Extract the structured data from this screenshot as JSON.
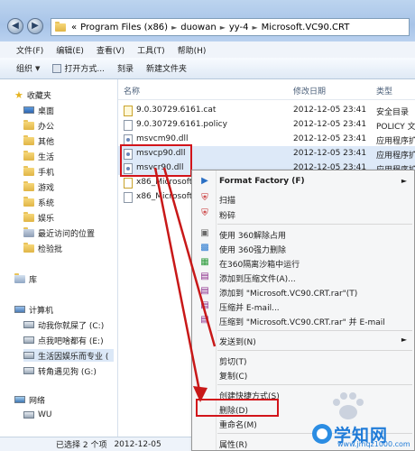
{
  "address": {
    "segments": [
      "«",
      "Program Files (x86)",
      "duowan",
      "yy-4",
      "Microsoft.VC90.CRT"
    ]
  },
  "menubar": [
    "文件(F)",
    "编辑(E)",
    "查看(V)",
    "工具(T)",
    "帮助(H)"
  ],
  "toolbar": {
    "organize": "组织",
    "open_with": "打开方式...",
    "burn": "刻录",
    "new_folder": "新建文件夹"
  },
  "navpane": {
    "favorites": "收藏夹",
    "items": [
      "桌面",
      "办公",
      "其他",
      "生活",
      "手机",
      "游戏",
      "系统",
      "娱乐",
      "最近访问的位置",
      "检验批"
    ],
    "library": "库",
    "computer": "计算机",
    "drives": [
      "动我你就屎了 (C:)",
      "点我吧啥都有 (E:)",
      "生活因娱乐而专业 (",
      "转角遇见狗 (G:)"
    ],
    "network": "网络",
    "network_items": [
      "WU"
    ]
  },
  "columns": {
    "name": "名称",
    "date": "修改日期",
    "type": "类型"
  },
  "files": [
    {
      "name": "9.0.30729.6161.cat",
      "date": "2012-12-05 23:41",
      "type": "安全目录"
    },
    {
      "name": "9.0.30729.6161.policy",
      "date": "2012-12-05 23:41",
      "type": "POLICY 文件"
    },
    {
      "name": "msvcm90.dll",
      "date": "2012-12-05 23:41",
      "type": "应用程序扩"
    },
    {
      "name": "msvcp90.dll",
      "date": "2012-12-05 23:41",
      "type": "应用程序扩"
    },
    {
      "name": "msvcr90.dll",
      "date": "2012-12-05 23:41",
      "type": "应用程序扩"
    },
    {
      "name": "x86_Microsoft.V",
      "date": "",
      "type": ""
    },
    {
      "name": "x86_Microsoft.V",
      "date": "",
      "type": ""
    }
  ],
  "context_menu": {
    "items": [
      {
        "label": "Format Factory (F)",
        "bold": true,
        "submenu": true
      },
      {
        "label": "扫描"
      },
      {
        "label": "粉碎"
      },
      {
        "sep": true
      },
      {
        "label": "使用 360解除占用"
      },
      {
        "label": "使用 360强力删除"
      },
      {
        "label": "在360隔离沙箱中运行"
      },
      {
        "label": "添加到压缩文件(A)..."
      },
      {
        "label": "添加到 \"Microsoft.VC90.CRT.rar\"(T)"
      },
      {
        "label": "压缩并 E-mail..."
      },
      {
        "label": "压缩到 \"Microsoft.VC90.CRT.rar\" 并 E-mail"
      },
      {
        "sep": true
      },
      {
        "label": "发送到(N)",
        "submenu": true
      },
      {
        "sep": true
      },
      {
        "label": "剪切(T)"
      },
      {
        "label": "复制(C)"
      },
      {
        "sep": true
      },
      {
        "label": "创建快捷方式(S)"
      },
      {
        "label": "删除(D)"
      },
      {
        "label": "重命名(M)"
      },
      {
        "sep": true
      },
      {
        "label": "属性(R)"
      }
    ]
  },
  "status": {
    "count": "已选择 2 个项",
    "date": "2012-12-05"
  },
  "watermark": {
    "brand": "学知网",
    "url": "www.jmqz1000.com"
  },
  "colors": {
    "highlight_red": "#d2141a",
    "selection": "#dde9f8",
    "menu_bg": "#f5f6f7"
  }
}
